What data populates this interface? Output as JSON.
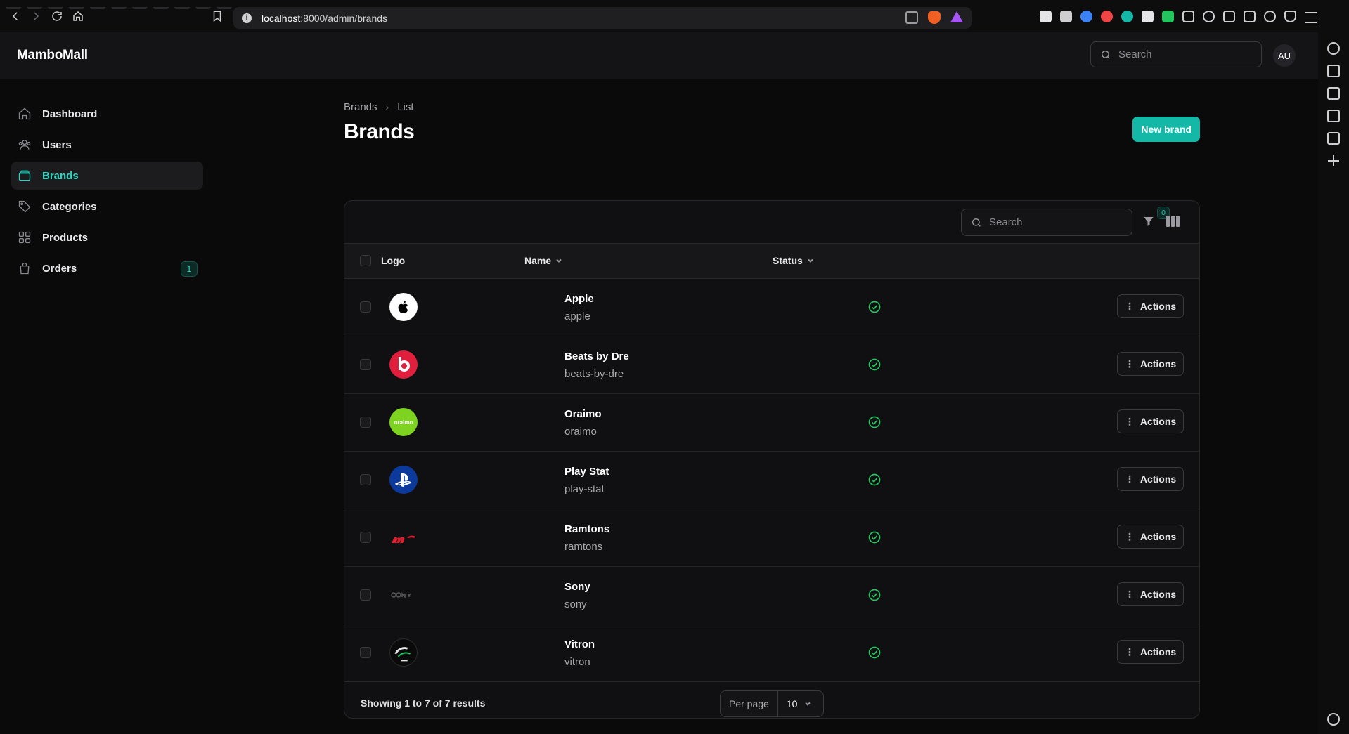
{
  "browser": {
    "url_host": "localhost",
    "url_path": ":8000/admin/brands"
  },
  "app": {
    "name": "MamboMall",
    "search_placeholder": "Search",
    "avatar_initials": "AU"
  },
  "sidebar": {
    "items": [
      {
        "label": "Dashboard",
        "icon": "home-icon"
      },
      {
        "label": "Users",
        "icon": "users-icon"
      },
      {
        "label": "Brands",
        "icon": "wallet-icon",
        "active": true
      },
      {
        "label": "Categories",
        "icon": "tag-icon"
      },
      {
        "label": "Products",
        "icon": "grid-icon"
      },
      {
        "label": "Orders",
        "icon": "bag-icon",
        "badge": "1"
      }
    ]
  },
  "page": {
    "breadcrumb": [
      "Brands",
      "List"
    ],
    "title": "Brands",
    "new_button": "New brand"
  },
  "table": {
    "search_placeholder": "Search",
    "filter_count": "0",
    "columns": {
      "logo": "Logo",
      "name": "Name",
      "status": "Status"
    },
    "action_label": "Actions",
    "rows": [
      {
        "name": "Apple",
        "slug": "apple"
      },
      {
        "name": "Beats by Dre",
        "slug": "beats-by-dre"
      },
      {
        "name": "Oraimo",
        "slug": "oraimo",
        "logo_text": "oraimo"
      },
      {
        "name": "Play Stat",
        "slug": "play-stat"
      },
      {
        "name": "Ramtons",
        "slug": "ramtons"
      },
      {
        "name": "Sony",
        "slug": "sony"
      },
      {
        "name": "Vitron",
        "slug": "vitron"
      }
    ],
    "showing_text": "Showing 1 to 7 of 7 results",
    "per_page_label": "Per page",
    "per_page_value": "10"
  },
  "colors": {
    "accent": "#14b8a6",
    "status_active": "#22c55e"
  }
}
